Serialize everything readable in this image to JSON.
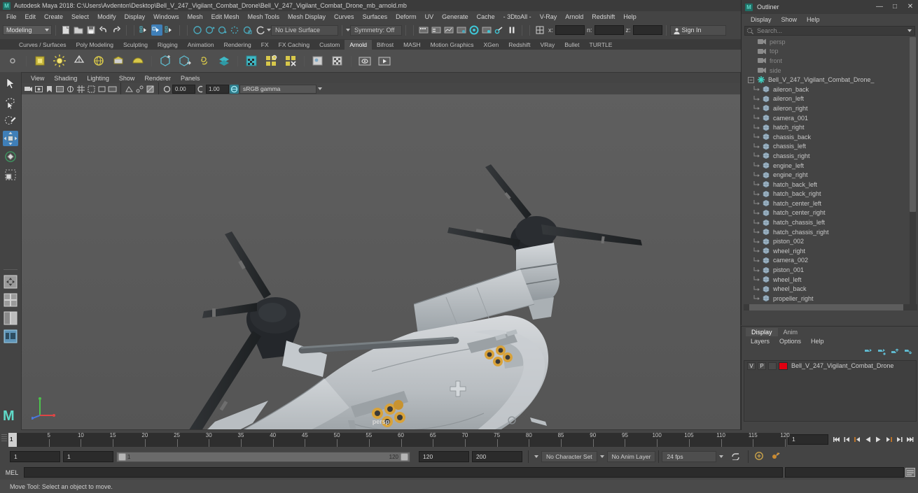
{
  "titlebar": {
    "logo": "M",
    "title": "Autodesk Maya 2018: C:\\Users\\Avdenton\\Desktop\\Bell_V_247_Vigilant_Combat_Drone\\Bell_V_247_Vigilant_Combat_Drone_mb_arnold.mb",
    "minimize": "—",
    "maximize": "□",
    "close": "✕"
  },
  "menubar": {
    "items": [
      "File",
      "Edit",
      "Create",
      "Select",
      "Modify",
      "Display",
      "Windows",
      "Mesh",
      "Edit Mesh",
      "Mesh Tools",
      "Mesh Display",
      "Curves",
      "Surfaces",
      "Deform",
      "UV",
      "Generate",
      "Cache",
      "- 3DtoAll -",
      "V-Ray",
      "Arnold",
      "Redshift",
      "Help"
    ]
  },
  "statusline": {
    "menuset": "Modeling",
    "live_surface": "No Live Surface",
    "symmetry": "Symmetry: Off",
    "coord_x_label": "x:",
    "coord_y_label": "n:",
    "coord_z_label": "z:",
    "coord_x_value": "",
    "coord_y_value": "",
    "coord_z_value": "",
    "signin": "Sign In"
  },
  "shelf": {
    "tabs": [
      "Curves / Surfaces",
      "Poly Modeling",
      "Sculpting",
      "Rigging",
      "Animation",
      "Rendering",
      "FX",
      "FX Caching",
      "Custom",
      "Arnold",
      "Bifrost",
      "MASH",
      "Motion Graphics",
      "XGen",
      "Redshift",
      "VRay",
      "Bullet",
      "TURTLE"
    ],
    "active_tab": "Arnold",
    "icons": [
      {
        "name": "arnold-area-light-icon"
      },
      {
        "name": "arnold-skydome-light-icon"
      },
      {
        "name": "arnold-mesh-light-icon"
      },
      {
        "name": "arnold-photometric-light-icon"
      },
      {
        "name": "arnold-light-portal-icon"
      },
      {
        "name": "arnold-physical-sky-icon"
      },
      {
        "name": "arnold-standin-create-icon"
      },
      {
        "name": "arnold-standin-export-icon"
      },
      {
        "name": "arnold-volume-icon"
      },
      {
        "name": "arnold-scene-source-icon"
      },
      {
        "name": "arnold-render-settings-icon"
      },
      {
        "name": "arnold-flush-caches-icon"
      },
      {
        "name": "arnold-clear-cache-icon"
      },
      {
        "name": "arnold-license-icon"
      },
      {
        "name": "arnold-bake-icon"
      },
      {
        "name": "arnold-open-render-view-icon"
      },
      {
        "name": "arnold-render-sequence-icon"
      }
    ]
  },
  "toolbox": {
    "tools": [
      {
        "name": "select-tool",
        "label": "Select Tool",
        "active": false
      },
      {
        "name": "lasso-select-tool",
        "label": "Lasso Select Tool",
        "active": false
      },
      {
        "name": "paint-select-tool",
        "label": "Paint Select Tool",
        "active": false
      },
      {
        "name": "move-tool",
        "label": "Move Tool",
        "active": true
      },
      {
        "name": "rotate-tool",
        "label": "Rotate Tool",
        "active": false
      },
      {
        "name": "scale-tool",
        "label": "Scale Tool",
        "active": false
      }
    ],
    "layouts": [
      {
        "name": "single-perspective-layout"
      },
      {
        "name": "four-view-layout"
      },
      {
        "name": "two-pane-side-layout"
      },
      {
        "name": "persp-outliner-layout"
      }
    ],
    "logo": "M"
  },
  "viewport": {
    "menus": [
      "View",
      "Shading",
      "Lighting",
      "Show",
      "Renderer",
      "Panels"
    ],
    "exposure_value": "0.00",
    "gamma_value": "1.00",
    "color_management": "sRGB gamma",
    "camera_label": "persp",
    "axis": {
      "x": "x",
      "y": "y",
      "z": "z"
    }
  },
  "outliner": {
    "logo": "M",
    "title": "Outliner",
    "minimize": "—",
    "maximize": "□",
    "close": "✕",
    "menus": [
      "Display",
      "Show",
      "Help"
    ],
    "search_placeholder": "Search...",
    "cameras": [
      "persp",
      "top",
      "front",
      "side"
    ],
    "group": {
      "name": "Bell_V_247_Vigilant_Combat_Drone_",
      "expander": "−"
    },
    "children": [
      "aileron_back",
      "aileron_left",
      "aileron_right",
      "camera_001",
      "hatch_right",
      "chassis_back",
      "chassis_left",
      "chassis_right",
      "engine_left",
      "engine_right",
      "hatch_back_left",
      "hatch_back_right",
      "hatch_center_left",
      "hatch_center_right",
      "hatch_chassis_left",
      "hatch_chassis_right",
      "piston_002",
      "wheel_right",
      "camera_002",
      "piston_001",
      "wheel_left",
      "wheel_back",
      "propeller_right"
    ]
  },
  "layer_editor": {
    "tabs": [
      "Display",
      "Anim"
    ],
    "active_tab": "Display",
    "menus": [
      "Layers",
      "Options",
      "Help"
    ],
    "buttons": [
      {
        "name": "new-layer-button"
      },
      {
        "name": "new-layer-from-selected-button"
      },
      {
        "name": "move-layer-up-button"
      },
      {
        "name": "move-layer-down-button"
      }
    ],
    "layers": [
      {
        "visibility": "V",
        "playback": "P",
        "shading": "",
        "color": "#e00010",
        "name": "Bell_V_247_Vigilant_Combat_Drone"
      }
    ]
  },
  "timeline": {
    "ticks": [
      5,
      10,
      15,
      20,
      25,
      30,
      35,
      40,
      45,
      50,
      55,
      60,
      65,
      70,
      75,
      80,
      85,
      90,
      95,
      100,
      105,
      110,
      115,
      120
    ],
    "current_frame": "1",
    "start": 1,
    "end": 120,
    "frame_field": "1",
    "playback_buttons": [
      {
        "name": "go-to-start-button"
      },
      {
        "name": "step-back-keyframe-button"
      },
      {
        "name": "step-back-frame-button"
      },
      {
        "name": "play-backwards-button"
      },
      {
        "name": "play-forwards-button"
      },
      {
        "name": "step-forward-frame-button"
      },
      {
        "name": "step-forward-keyframe-button"
      },
      {
        "name": "go-to-end-button"
      }
    ]
  },
  "range_slider": {
    "anim_start": "1",
    "range_start": "1",
    "bar_start_label": "1",
    "bar_end_label": "120",
    "range_end": "120",
    "anim_end": "200",
    "character_set": "No Character Set",
    "anim_layer": "No Anim Layer",
    "fps": "24 fps",
    "auto_key_name": "auto-keyframe-toggle",
    "prefs_name": "animation-preferences-button"
  },
  "command_line": {
    "language": "MEL",
    "input_value": "",
    "output_value": ""
  },
  "help_line": {
    "text": "Move Tool: Select an object to move."
  },
  "colors": {
    "accent_blue": "#3f7fb8",
    "teal": "#5fd9c8",
    "arnold_yellow": "#d8c84a",
    "layer_red": "#e00010",
    "orange": "#e08020"
  }
}
